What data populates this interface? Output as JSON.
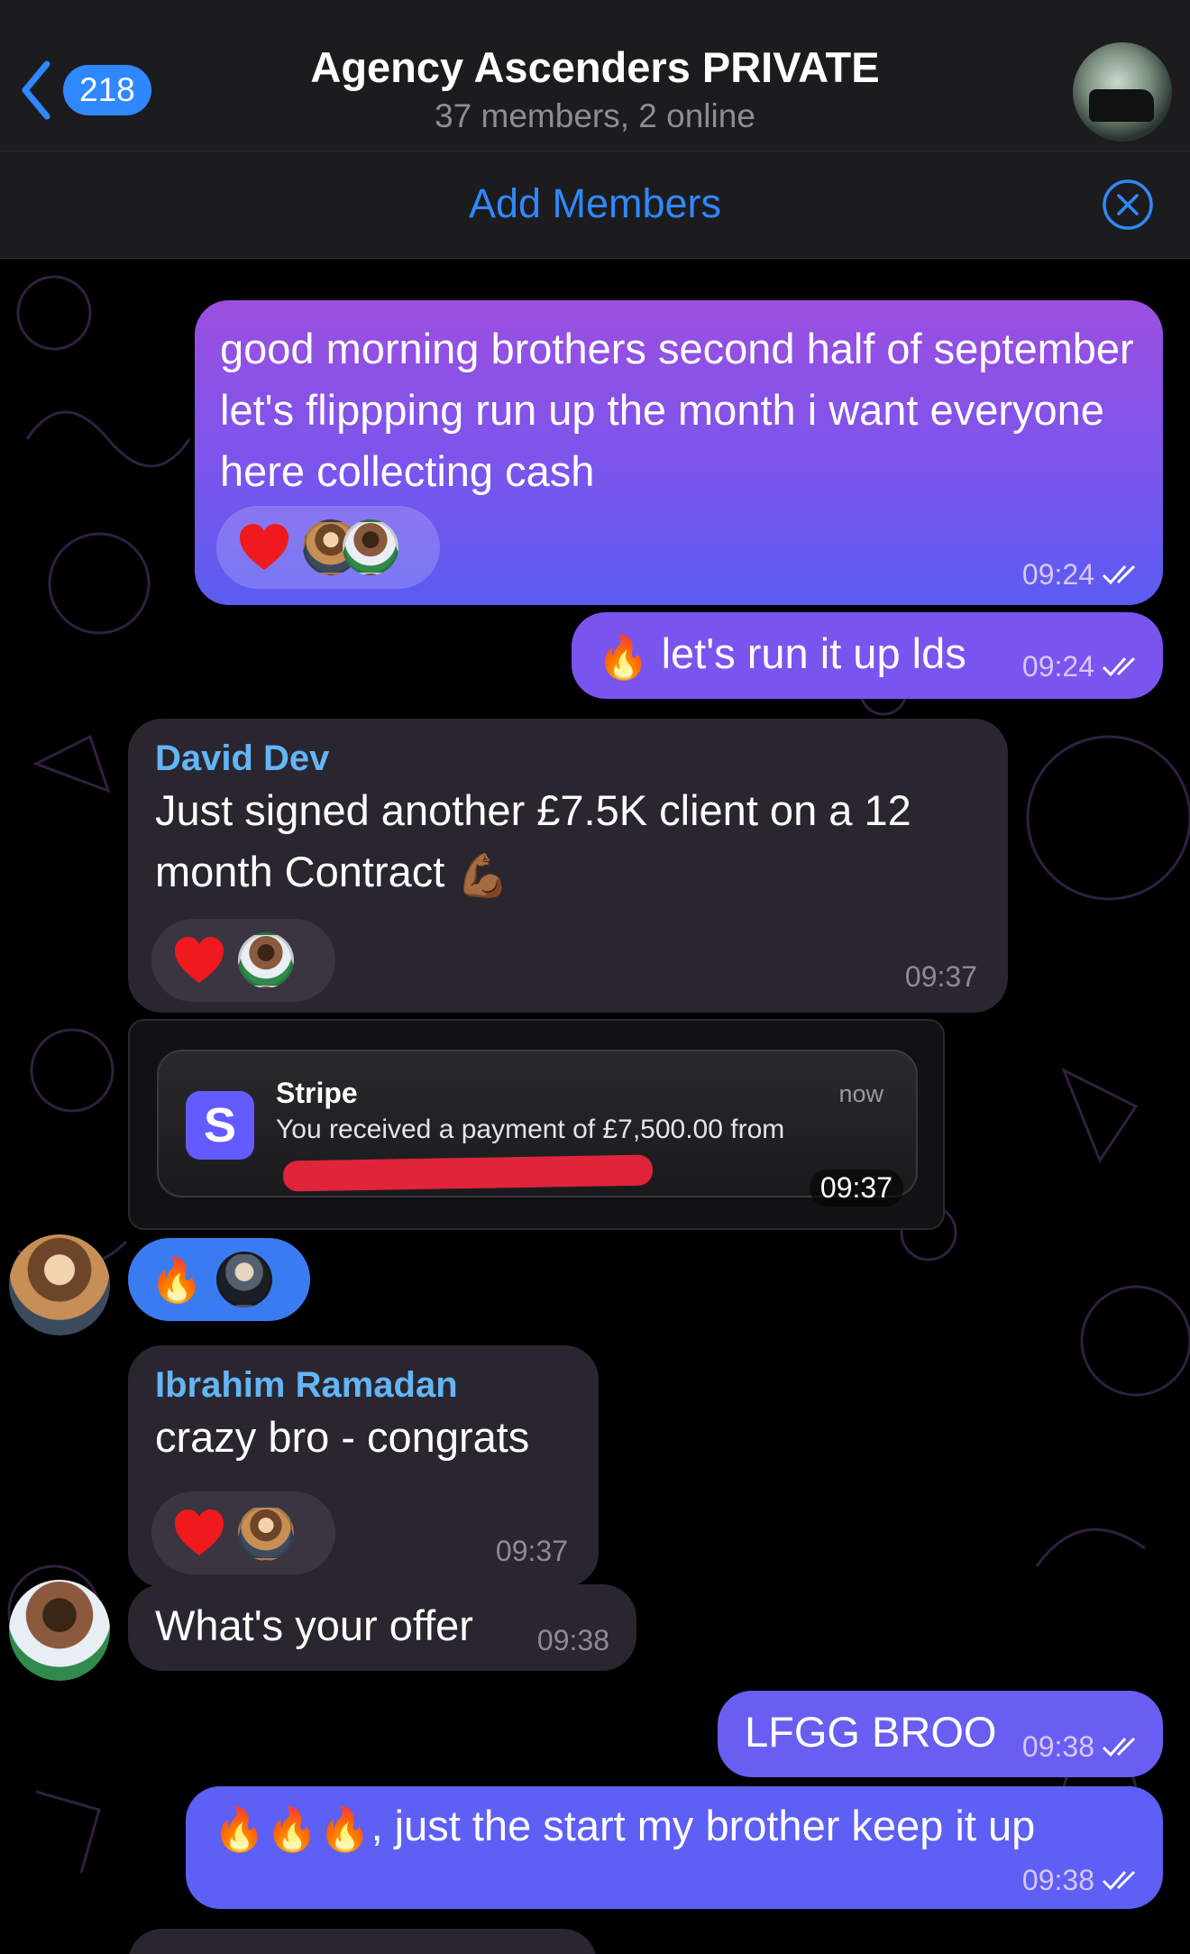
{
  "header": {
    "back_count": "218",
    "title": "Agency Ascenders PRIVATE",
    "subtitle": "37 members, 2 online",
    "back_icon": "chevron-left-icon",
    "accent": "#2f88ff"
  },
  "add_bar": {
    "label": "Add Members",
    "close_icon": "close-circle-icon"
  },
  "messages": [
    {
      "text": "good morning brothers second half of september let's flippping run up the month i want everyone here collecting cash",
      "time": "09:24"
    },
    {
      "emoji": "🔥",
      "text": "let's run it up lds",
      "time": "09:24"
    },
    {
      "sender": "David Dev",
      "text": "Just signed another £7.5K client on a 12 month Contract",
      "emoji": "💪🏾",
      "time": "09:37"
    },
    {
      "stripe": {
        "app": "Stripe",
        "when": "now",
        "text": "You received a payment of £7,500.00 from"
      },
      "time": "09:37"
    },
    {
      "emoji": "🔥"
    },
    {
      "sender": "Ibrahim Ramadan",
      "text": "crazy bro - congrats",
      "time": "09:37"
    },
    {
      "text": "What's your offer",
      "time": "09:38"
    },
    {
      "text": "LFGG BROO",
      "time": "09:38"
    },
    {
      "emoji": "🔥🔥🔥",
      "text": ", just the start my brother keep it up",
      "time": "09:38"
    }
  ],
  "reaction_heart": "❤️",
  "colors": {
    "out_bubble": "#8a55ea",
    "in_bubble": "#2a262f",
    "sender_name": "#64b5f6"
  }
}
